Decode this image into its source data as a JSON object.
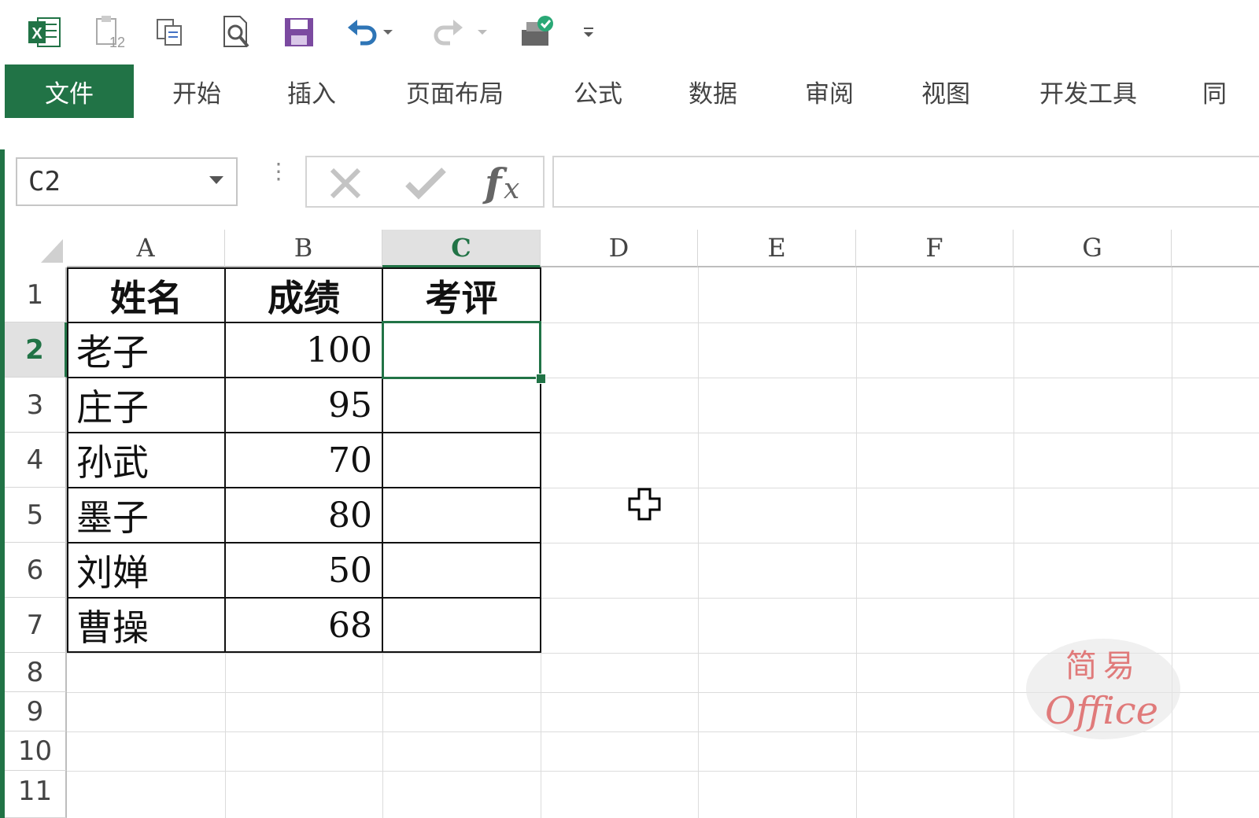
{
  "app": {
    "accent": "#217346"
  },
  "quick_access": [
    {
      "icon": "excel-logo-icon"
    },
    {
      "icon": "clipboard-icon"
    },
    {
      "icon": "copy-icon"
    },
    {
      "icon": "print-preview-icon"
    },
    {
      "icon": "save-icon"
    },
    {
      "icon": "undo-icon"
    },
    {
      "icon": "redo-icon"
    },
    {
      "icon": "share-icon"
    },
    {
      "icon": "customize-toolbar-icon"
    }
  ],
  "tabs": [
    "文件",
    "开始",
    "插入",
    "页面布局",
    "公式",
    "数据",
    "审阅",
    "视图",
    "开发工具",
    "同"
  ],
  "namebox": {
    "value": "C2"
  },
  "formula": {
    "value": ""
  },
  "columns": [
    "A",
    "B",
    "C",
    "D",
    "E",
    "F",
    "G"
  ],
  "rows": [
    "1",
    "2",
    "3",
    "4",
    "5",
    "6",
    "7",
    "8",
    "9",
    "10",
    "11"
  ],
  "selected_cell": {
    "column": "C",
    "row": "2"
  },
  "sheet": {
    "headers": [
      "姓名",
      "成绩",
      "考评"
    ],
    "records": [
      {
        "name": "老子",
        "score": "100",
        "rating": ""
      },
      {
        "name": "庄子",
        "score": "95",
        "rating": ""
      },
      {
        "name": "孙武",
        "score": "70",
        "rating": ""
      },
      {
        "name": "墨子",
        "score": "80",
        "rating": ""
      },
      {
        "name": "刘婵",
        "score": "50",
        "rating": ""
      },
      {
        "name": "曹操",
        "score": "68",
        "rating": ""
      }
    ]
  },
  "watermark": {
    "line1": "简易",
    "line2": "Office"
  }
}
